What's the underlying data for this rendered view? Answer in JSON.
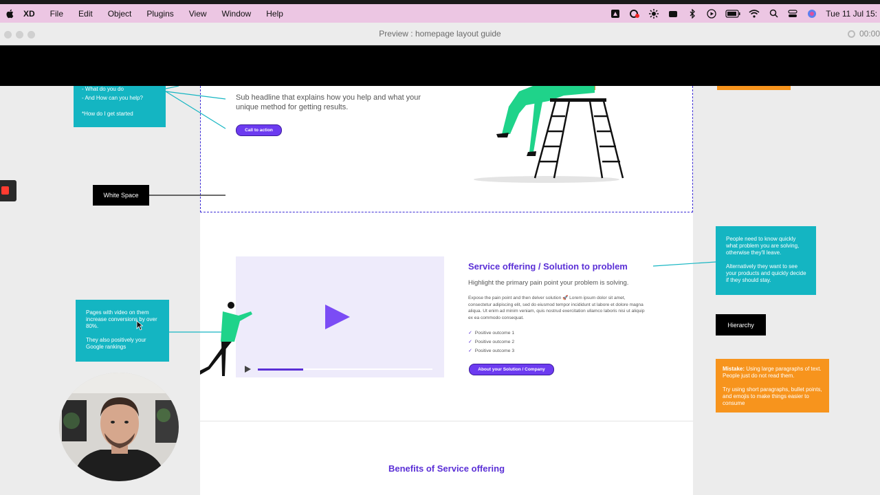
{
  "menubar": {
    "app": "XD",
    "items": [
      "File",
      "Edit",
      "Object",
      "Plugins",
      "View",
      "Window",
      "Help"
    ],
    "clock": "Tue 11 Jul 15:"
  },
  "window": {
    "title": "Preview : homepage layout guide",
    "recording_time": "00:00"
  },
  "annotations": {
    "hero_note": [
      "- What do you do",
      "- And How can you help?",
      "",
      "*How do I get started"
    ],
    "white_space_label": "White Space",
    "video_note": [
      "Pages with video on them increase conversions by over 80%.",
      "They also positively your Google rankings"
    ],
    "problem_note": [
      "People need to know quickly what problem you are solving, otherwise they'll leave.",
      "Alternatively they want to see your products and quickly decide if they should stay."
    ],
    "hierarchy_label": "Hierarchy",
    "mistake_note": {
      "heading": "Mistake:",
      "text": "Using large paragraphs of text. People just do not read them.",
      "tip": "Try using short paragraphs, bullet points, and emojis to make things easier to consume"
    }
  },
  "hero": {
    "subheadline": "Sub headline that explains how you help and what your unique method for getting results.",
    "cta": "Call to action"
  },
  "service": {
    "title": "Service offering / Solution to problem",
    "subtitle": "Highlight the primary pain point your problem is solving.",
    "body": "Expose the pain point and then delver solution 🚀 Lorem ipsum dolor sit amet, consectetur adipiscing elit, sed do eiusmod tempor incididunt ut labore et dolore magna aliqua. Ut enim ad minim veniam, quis nostrud exercitation ullamco laboris nisi ut aliquip ex ea commodo consequat.",
    "outcomes": [
      "Positive outcome 1",
      "Positive outcome 2",
      "Positive outcome 3"
    ],
    "button": "About your Solution / Company",
    "video_progress": 0.26
  },
  "benefits_title": "Benefits of Service offering",
  "colors": {
    "purple": "#5a2fd6",
    "teal": "#14b5c2",
    "orange": "#f7941d",
    "menubar": "#ecc6e3"
  }
}
